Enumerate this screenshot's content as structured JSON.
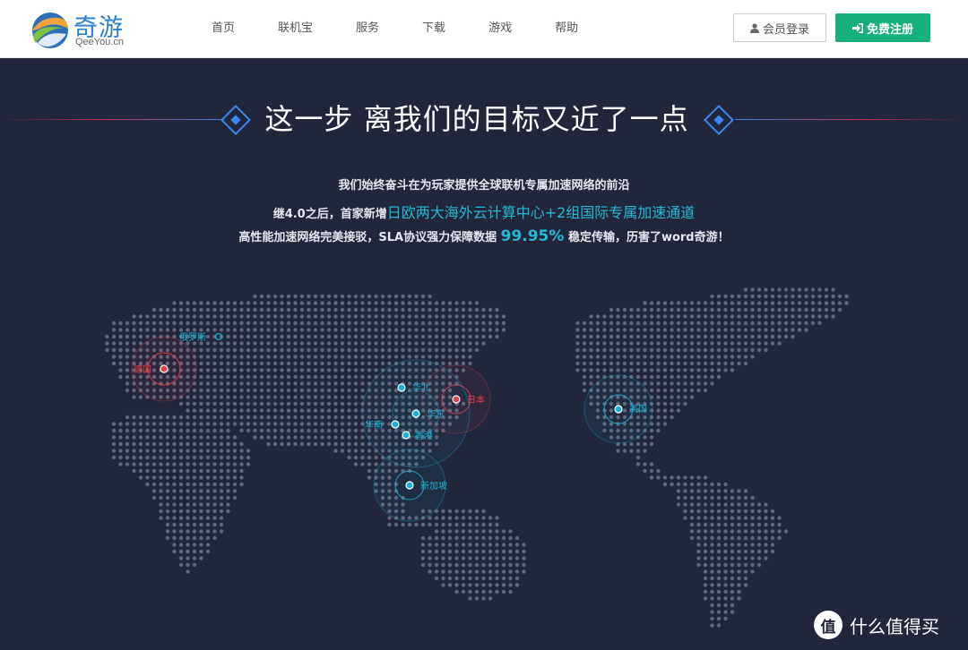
{
  "header": {
    "logo_cn": "奇游",
    "logo_en": "QeeYou.cn",
    "nav": [
      "首页",
      "联机宝",
      "服务",
      "下载",
      "游戏",
      "帮助"
    ],
    "login_label": "会员登录",
    "register_label": "免费注册",
    "login_icon": "user-icon",
    "register_icon": "sign-in-icon"
  },
  "hero": {
    "title": "这一步 离我们的目标又近了一点",
    "line1": "我们始终奋斗在为玩家提供全球联机专属加速网络的前沿",
    "line2_prefix": "继4.0之后，首家新增",
    "line2_highlight": "日欧两大海外云计算中心+2组国际专属加速通道",
    "line3_prefix": "高性能加速网络完美接驳，SLA协议强力保障数据",
    "line3_number": "99.95%",
    "line3_suffix": "稳定传输，历害了word奇游！"
  },
  "map": {
    "nodes": [
      {
        "label": "俄罗斯",
        "kind": "outline"
      },
      {
        "label": "德国",
        "kind": "red"
      },
      {
        "label": "日本",
        "kind": "red"
      },
      {
        "label": "华北",
        "kind": "blue"
      },
      {
        "label": "华东",
        "kind": "blue"
      },
      {
        "label": "华南",
        "kind": "blue"
      },
      {
        "label": "香港",
        "kind": "blue"
      },
      {
        "label": "新加坡",
        "kind": "blue"
      },
      {
        "label": "美国",
        "kind": "blue"
      }
    ],
    "colors": {
      "blue": "#1ab3d6",
      "red": "#e8404a",
      "dots": "#62667a",
      "background": "#22263a"
    }
  },
  "watermark": {
    "badge": "值",
    "text": "什么值得买"
  }
}
